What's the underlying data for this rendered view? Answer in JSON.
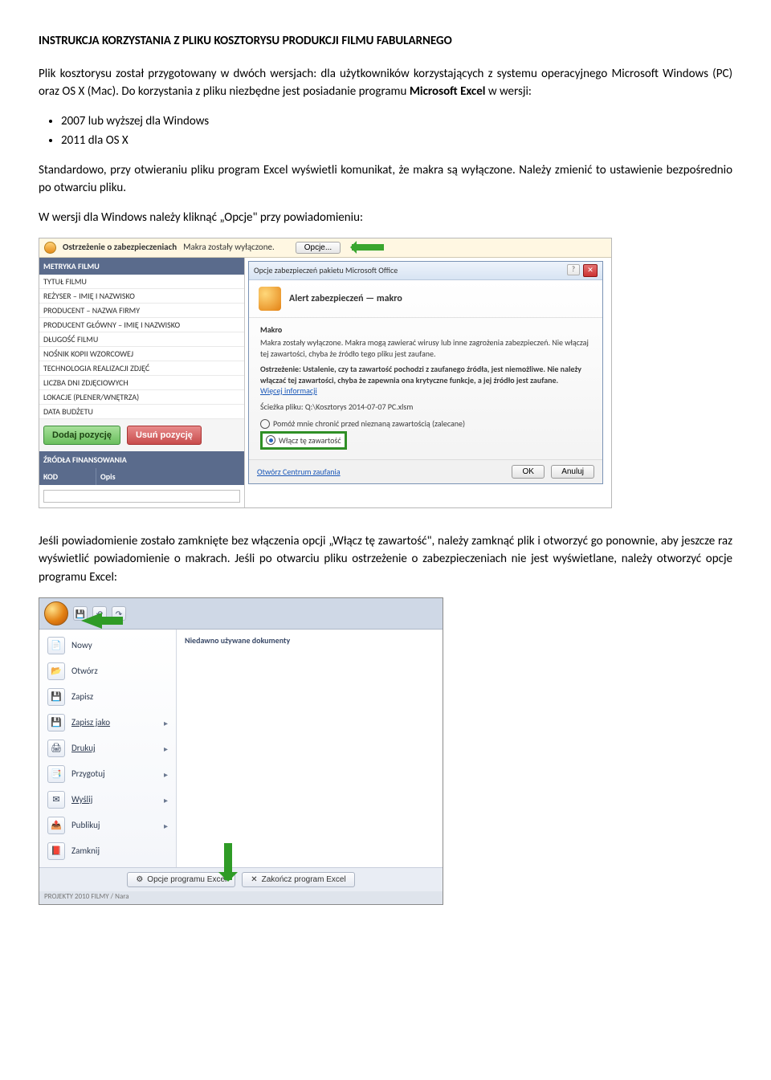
{
  "title": "INSTRUKCJA KORZYSTANIA Z PLIKU KOSZTORYSU PRODUKCJI FILMU FABULARNEGO",
  "intro_p1": "Plik kosztorysu został przygotowany w dwóch wersjach: dla użytkowników korzystających z systemu operacyjnego Microsoft Windows (PC) oraz OS X (Mac). Do korzystania z pliku niezbędne jest posiadanie programu Microsoft Excel w wersji:",
  "bullets": [
    "2007 lub wyższej dla Windows",
    "2011 dla OS X"
  ],
  "intro_p2": "Standardowo, przy otwieraniu pliku program Excel wyświetli komunikat, że makra są wyłączone. Należy zmienić to ustawienie bezpośrednio po otwarciu pliku.",
  "intro_p3": "W wersji dla Windows należy kliknąć „Opcje\" przy powiadomieniu:",
  "shot1": {
    "warn_label": "Ostrzeżenie o zabezpieczeniach",
    "warn_text": "Makra zostały wyłączone.",
    "opcje": "Opcje...",
    "section_metryka": "METRYKA FILMU",
    "labels": [
      "TYTUŁ FILMU",
      "REŻYSER – IMIĘ I NAZWISKO",
      "PRODUCENT – NAZWA FIRMY",
      "PRODUCENT GŁÓWNY – IMIĘ I NAZWISKO",
      "DŁUGOŚĆ FILMU",
      "NOŚNIK KOPII WZORCOWEJ",
      "TECHNOLOGIA REALIZACJI ZDJĘĆ",
      "LICZBA DNI ZDJĘCIOWYCH",
      "LOKACJE (PLENER/WNĘTRZA)",
      "DATA BUDŻETU"
    ],
    "btn_add": "Dodaj pozycję",
    "btn_del": "Usuń pozycję",
    "section_zrodla": "ŹRÓDŁA FINANSOWANIA",
    "col_kod": "KOD",
    "col_opis": "Opis",
    "dlg_title": "Opcje zabezpieczeń pakietu Microsoft Office",
    "dlg_h": "Alert zabezpieczeń — makro",
    "makro": "Makro",
    "m1": "Makra zostały wyłączone. Makra mogą zawierać wirusy lub inne zagrożenia zabezpieczeń. Nie włączaj tej zawartości, chyba że źródło tego pliku jest zaufane.",
    "m2a": "Ostrzeżenie: Ustalenie, czy ta zawartość pochodzi z zaufanego źródła, jest niemożliwe. Nie należy włączać tej zawartości, chyba że zapewnia ona krytyczne funkcje, a jej źródło jest zaufane.",
    "more": "Więcej informacji",
    "path_l": "Ścieżka pliku:",
    "path_v": "Q:\\Kosztorys 2014-07-07 PC.xlsm",
    "opt1": "Pomóż mnie chronić przed nieznaną zawartością (zalecane)",
    "opt2": "Włącz tę zawartość",
    "trust": "Otwórz Centrum zaufania",
    "ok": "OK",
    "cancel": "Anuluj"
  },
  "mid_p": "Jeśli powiadomienie zostało zamknięte bez włączenia opcji „Włącz tę zawartość\", należy zamknąć plik i otworzyć go ponownie, aby jeszcze raz wyświetlić powiadomienie o makrach. Jeśli po otwarciu pliku ostrzeżenie o zabezpieczeniach nie jest wyświetlane, należy otworzyć opcje programu Excel:",
  "shot2": {
    "recent": "Niedawno używane dokumenty",
    "items": [
      {
        "icon": "📄",
        "label": "Nowy"
      },
      {
        "icon": "📂",
        "label": "Otwórz"
      },
      {
        "icon": "💾",
        "label": "Zapisz"
      },
      {
        "icon": "💾",
        "label": "Zapisz jako",
        "sub": true
      },
      {
        "icon": "🖨",
        "label": "Drukuj",
        "sub": true
      },
      {
        "icon": "📑",
        "label": "Przygotuj",
        "sub": true
      },
      {
        "icon": "✉",
        "label": "Wyślij",
        "sub": true
      },
      {
        "icon": "📤",
        "label": "Publikuj",
        "sub": true
      },
      {
        "icon": "📕",
        "label": "Zamknij"
      }
    ],
    "foot1": "Opcje programu Excel",
    "foot2": "Zakończ program Excel",
    "cut": "PROJEKTY 2010 FILMY / Nara"
  }
}
